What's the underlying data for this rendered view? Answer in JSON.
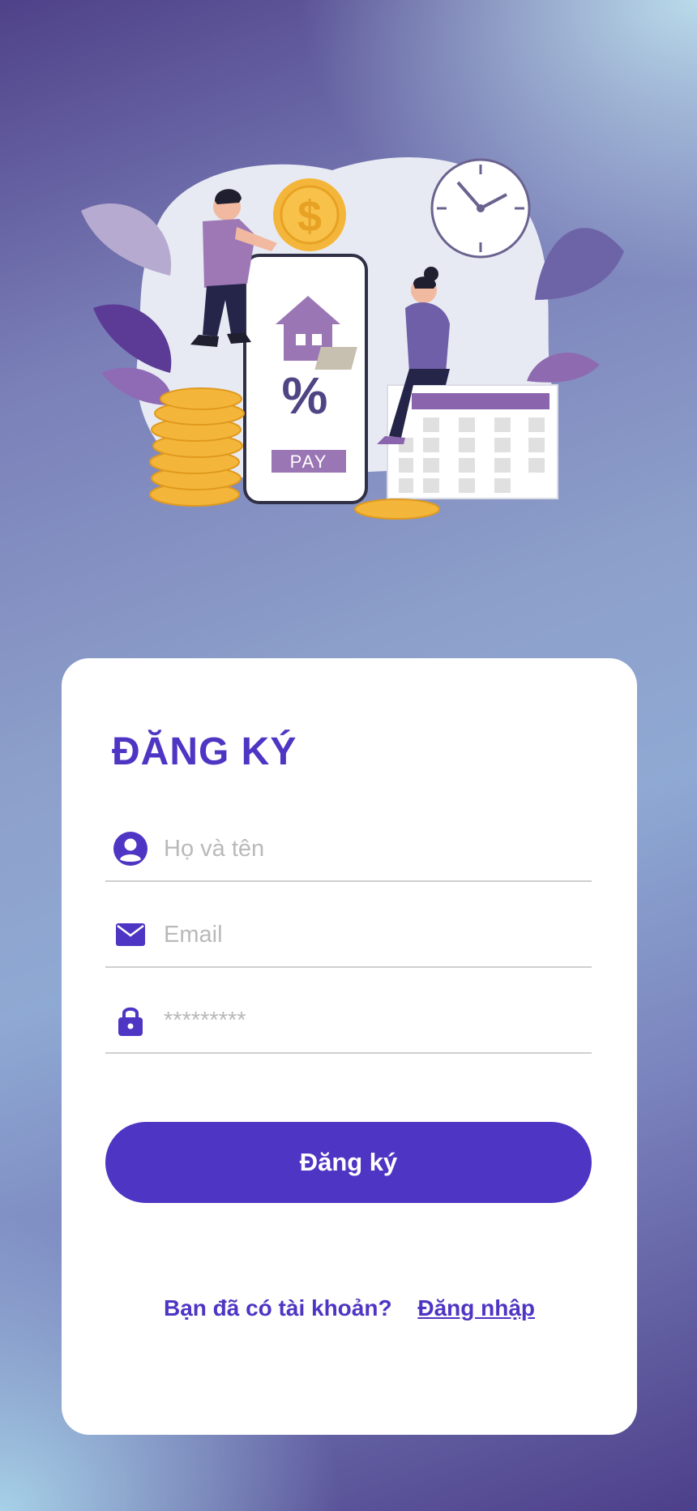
{
  "hero": {
    "pay_label": "PAY",
    "percent_symbol": "%",
    "dollar_symbol": "$"
  },
  "form": {
    "title": "ĐĂNG KÝ",
    "name_placeholder": "Họ và tên",
    "email_placeholder": "Email",
    "password_placeholder": "*********",
    "submit_label": "Đăng ký",
    "login_prompt": "Bạn đã có tài khoản?",
    "login_link": "Đăng nhập"
  },
  "colors": {
    "accent": "#4e35c3",
    "card": "#ffffff",
    "placeholder": "#b9b9b9"
  },
  "icons": {
    "name_field": "user-circle-icon",
    "email_field": "envelope-icon",
    "password_field": "lock-icon"
  }
}
